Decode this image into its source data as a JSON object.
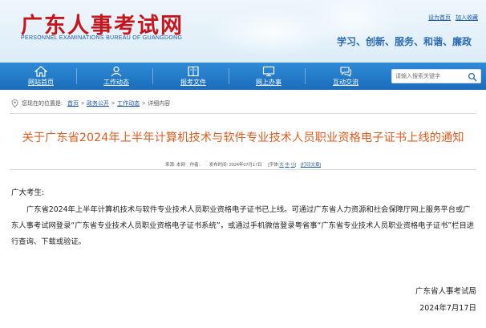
{
  "header": {
    "site_title": "广东人事考试网",
    "site_subtitle": "PERSONNEL EXAMINATIONS BUREAU OF GUANGDONG",
    "top_links": [
      "设为首页",
      "加入收藏"
    ],
    "slogan": "学习、创新、服务、和谐、廉政"
  },
  "nav": {
    "items": [
      {
        "label": "网站首页",
        "icon": "home-icon"
      },
      {
        "label": "工作动态",
        "icon": "person-icon"
      },
      {
        "label": "报考文件",
        "icon": "book-icon"
      },
      {
        "label": "网上办事",
        "icon": "monitor-icon"
      },
      {
        "label": "互动交流",
        "icon": "chat-icon"
      }
    ],
    "search_placeholder": "请输入搜索关键字"
  },
  "breadcrumb": {
    "prefix": "您现在的位置是:",
    "items": [
      "首页",
      "政务公开",
      "工作动态"
    ],
    "current": "详细内容"
  },
  "article": {
    "title": "关于广东省2024年上半年计算机技术与软件专业技术人员职业资格电子证书上线的通知",
    "meta_source": "来源: 本网",
    "meta_author": "作者:",
    "meta_date": "发布时间: 2024年07月17日",
    "meta_font_prefix": "[字体:",
    "meta_font_large": "大",
    "meta_font_medium": "中",
    "meta_font_small": "小",
    "meta_font_suffix": "]",
    "meta_print": "[打印文章]",
    "salutation": "广大考生:",
    "paragraph": "广东省2024年上半年计算机技术与软件专业技术人员职业资格电子证书已上线。可通过广东省人力资源和社会保障厅网上服务平台或广东人事考试网登录“广东省专业技术人员职业资格电子证书系统”，或通过手机微信登录粤省事“广东省专业技术人员职业资格电子证书”栏目进行查询、下载或验证。",
    "signature": "广东省人事考试局",
    "date": "2024年7月17日"
  },
  "colors": {
    "brand_red": "#c9141c",
    "nav_blue": "#1b6dbb",
    "title_orange": "#e25c1f",
    "link_blue": "#1a55a6"
  }
}
